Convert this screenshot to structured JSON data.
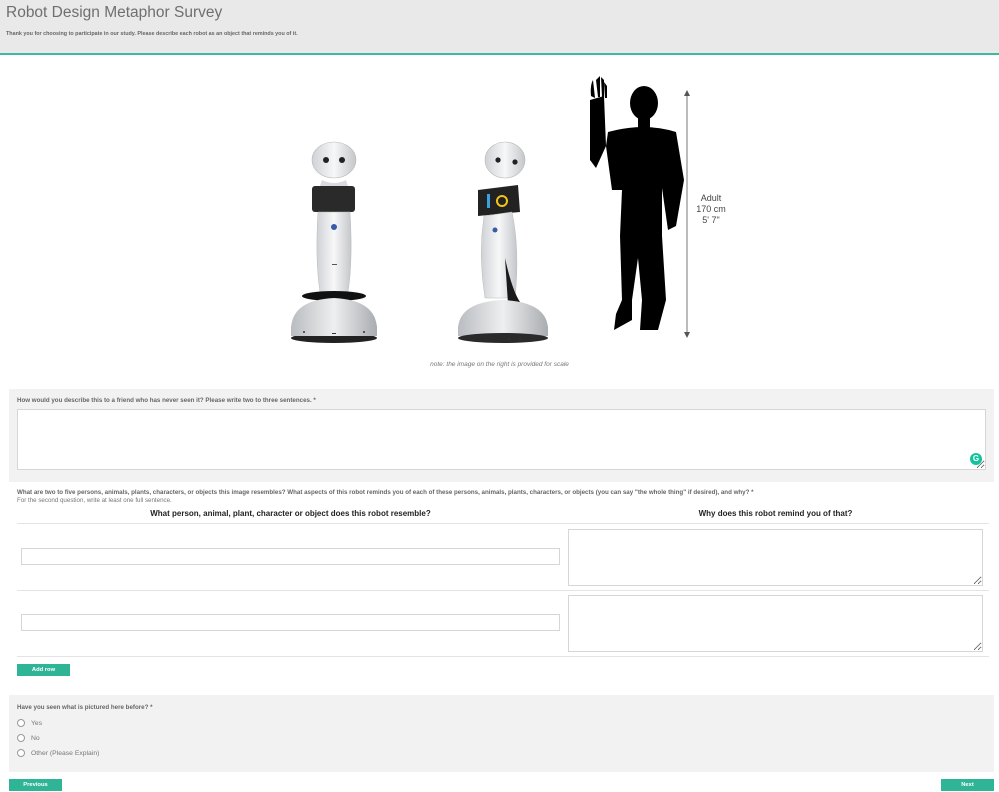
{
  "header": {
    "title": "Robot Design Metaphor Survey",
    "intro": "Thank you for choosing to participate in our study. Please describe each robot as an object that reminds you of it."
  },
  "figure": {
    "scale_label": [
      "Adult",
      "170 cm",
      "5' 7\""
    ],
    "caption": "note: the image on the right is provided for scale"
  },
  "q1": {
    "label": "How would you describe this to a friend who has never seen it? Please write two to three sentences. *",
    "value": ""
  },
  "q2": {
    "label": "What are two to five persons, animals, plants, characters, or objects this image resembles? What aspects of this robot reminds you of each of these persons, animals, plants, characters, or objects (you can say \"the whole thing\" if desired), and why? *",
    "sub": "For the second question, write at least one full sentence.",
    "col1": "What person, animal, plant, character or object does this robot resemble?",
    "col2": "Why does this robot remind you of that?",
    "rows": [
      {
        "resemble": "",
        "why": ""
      },
      {
        "resemble": "",
        "why": ""
      }
    ],
    "add_row": "Add row"
  },
  "q3": {
    "label": "Have you seen what is pictured here before? *",
    "options": [
      "Yes",
      "No",
      "Other (Please Explain)"
    ]
  },
  "nav": {
    "previous": "Previous",
    "next": "Next"
  },
  "colors": {
    "accent": "#2fb596",
    "header_bg": "#e9e9e9",
    "panel_bg": "#f2f2f2"
  }
}
